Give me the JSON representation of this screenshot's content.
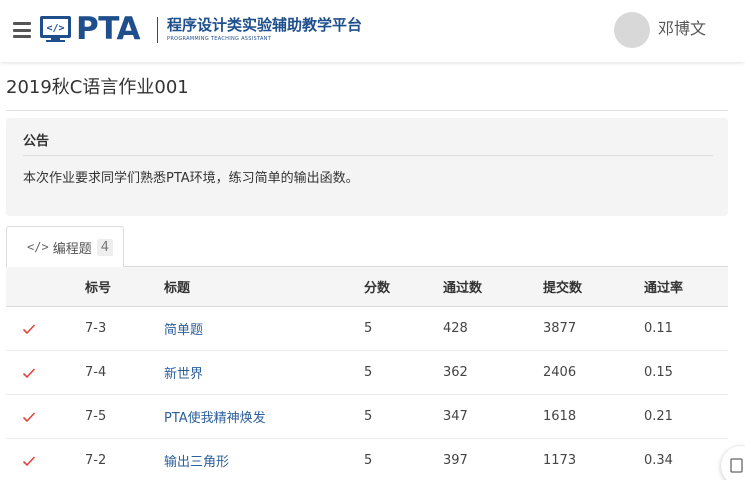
{
  "header": {
    "brand": "PTA",
    "brand_cn": "程序设计类实验辅助教学平台",
    "brand_en": "PROGRAMMING TEACHING ASSISTANT",
    "username": "邓博文"
  },
  "page": {
    "title": "2019秋C语言作业001"
  },
  "notice": {
    "heading": "公告",
    "body": "本次作业要求同学们熟悉PTA环境，练习简单的输出函数。"
  },
  "tabs": [
    {
      "icon": "code-icon",
      "label": "编程题",
      "count": "4"
    }
  ],
  "table": {
    "headers": {
      "id": "标号",
      "title": "标题",
      "score": "分数",
      "passed": "通过数",
      "submitted": "提交数",
      "rate": "通过率"
    },
    "rows": [
      {
        "id": "7-3",
        "title": "简单题",
        "score": "5",
        "passed": "428",
        "submitted": "3877",
        "rate": "0.11"
      },
      {
        "id": "7-4",
        "title": "新世界",
        "score": "5",
        "passed": "362",
        "submitted": "2406",
        "rate": "0.15"
      },
      {
        "id": "7-5",
        "title": "PTA使我精神焕发",
        "score": "5",
        "passed": "347",
        "submitted": "1618",
        "rate": "0.21"
      },
      {
        "id": "7-2",
        "title": "输出三角形",
        "score": "5",
        "passed": "397",
        "submitted": "1173",
        "rate": "0.34"
      }
    ]
  },
  "colors": {
    "brand": "#1e4e8c",
    "link": "#2d5f9a",
    "check": "#e0473c"
  }
}
